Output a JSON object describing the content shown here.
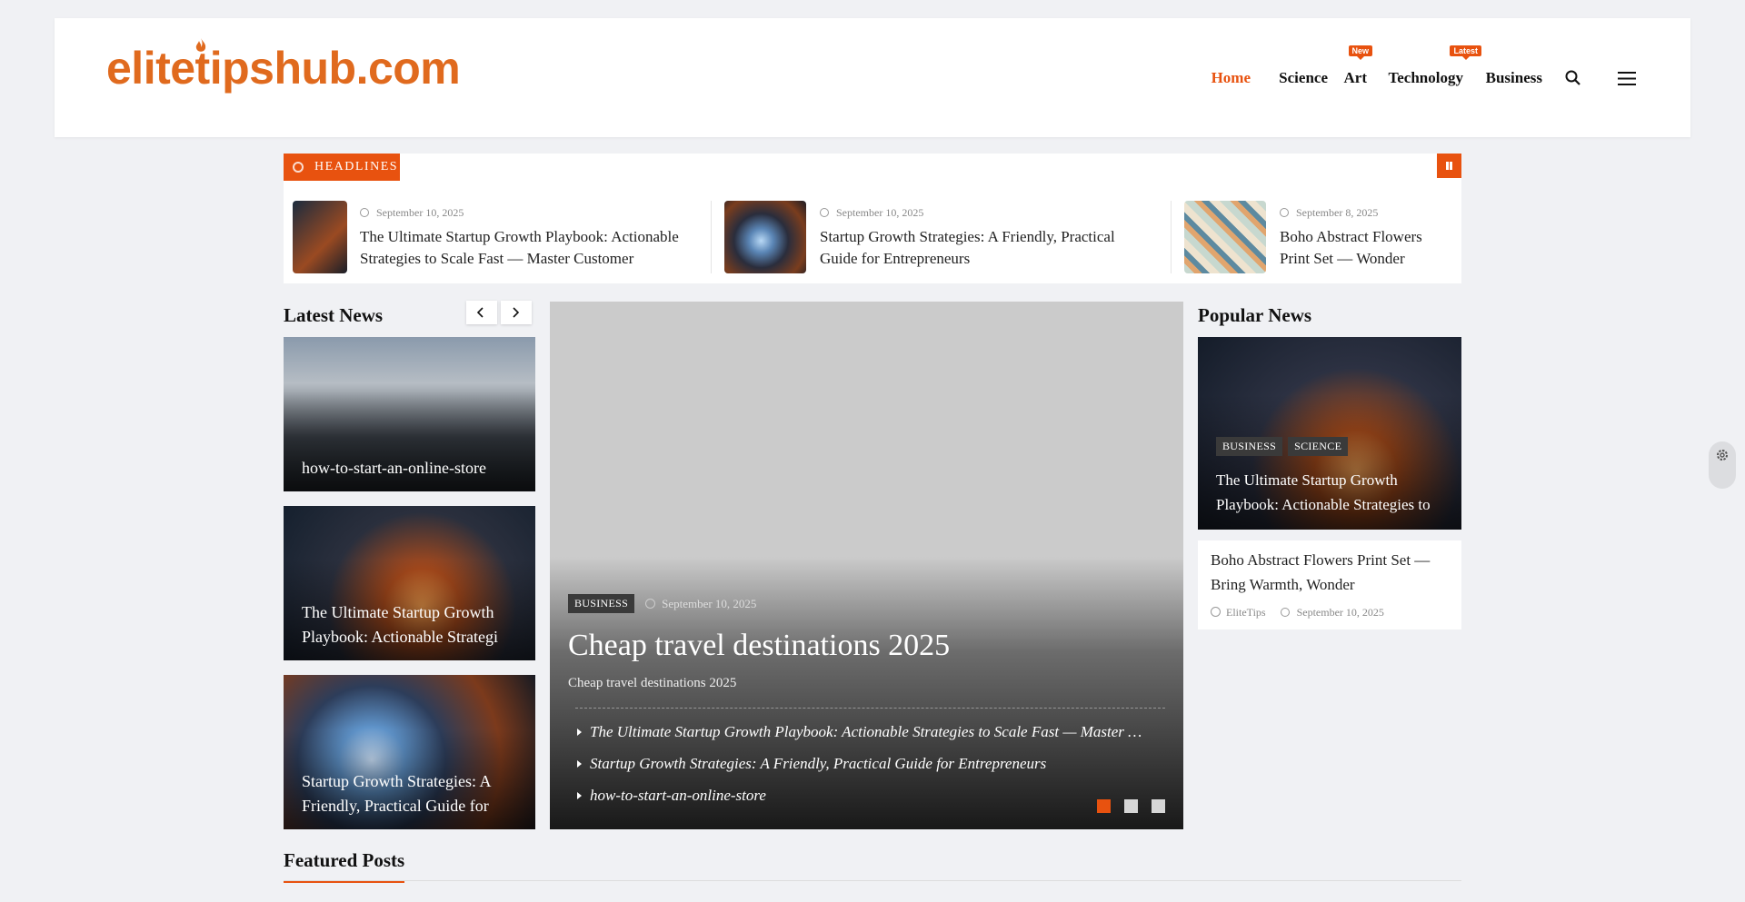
{
  "site": {
    "logo": "elitetipshub.com"
  },
  "nav": {
    "items": [
      {
        "label": "Home",
        "active": true
      },
      {
        "label": "Science"
      },
      {
        "label": "Art",
        "badge": "New"
      },
      {
        "label": "Technology",
        "badge": "Latest"
      },
      {
        "label": "Business"
      }
    ],
    "icons": [
      "search-icon",
      "menu-icon"
    ]
  },
  "headlines": {
    "label": "HEADLINES",
    "items": [
      {
        "date": "September 10, 2025",
        "title": "The Ultimate Startup Growth Playbook: Actionable Strategies to Scale Fast — Master Customer Acquisiti…"
      },
      {
        "date": "September 10, 2025",
        "title": "Startup Growth Strategies: A Friendly, Practical Guide for Entrepreneurs"
      },
      {
        "date": "September 8, 2025",
        "title": "Boho Abstract Flowers Print Set — Wonder"
      }
    ]
  },
  "latest": {
    "title": "Latest News",
    "cards": [
      {
        "title": "how-to-start-an-online-store"
      },
      {
        "title": "The Ultimate Startup Growth Playbook: Actionable Strategi"
      },
      {
        "title": "Startup Growth Strategies: A Friendly, Practical Guide for"
      }
    ]
  },
  "slider": {
    "tag": "BUSINESS",
    "date": "September 10, 2025",
    "title": "Cheap travel destinations 2025",
    "subtitle": "Cheap travel destinations 2025",
    "list": [
      "The Ultimate Startup Growth Playbook: Actionable Strategies to Scale Fast — Master Customer Acquisition",
      "Startup Growth Strategies: A Friendly, Practical Guide for Entrepreneurs",
      "how-to-start-an-online-store"
    ],
    "active_dot": 1,
    "dot_count": 3
  },
  "popular": {
    "title": "Popular News",
    "feature": {
      "tags": [
        "BUSINESS",
        "SCIENCE"
      ],
      "title": "The Ultimate Startup Growth Playbook: Actionable Strategies to"
    },
    "card": {
      "title": "Boho Abstract Flowers Print Set — Bring Warmth, Wonder",
      "author": "EliteTips",
      "date": "September 10, 2025"
    }
  },
  "featured": {
    "title": "Featured Posts"
  },
  "colors": {
    "accent": "#e8520f",
    "logo": "#e06a1e"
  }
}
